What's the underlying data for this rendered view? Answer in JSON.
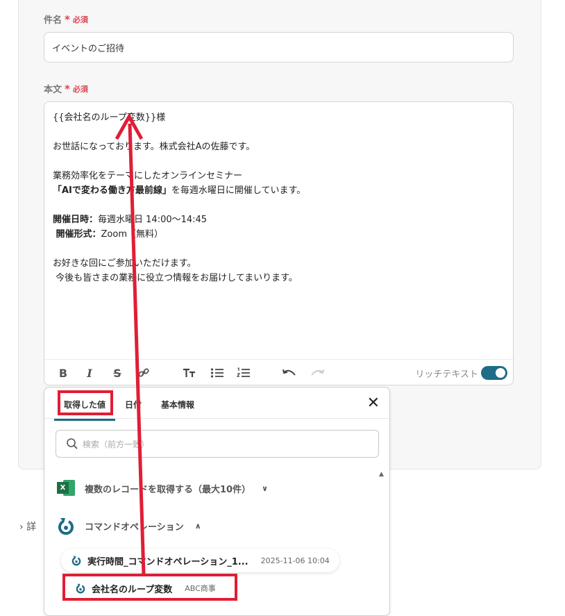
{
  "form": {
    "subject_label": "件名",
    "body_label": "本文",
    "required_star": "*",
    "required_text": "必須",
    "subject_value": "イベントのご招待",
    "body_lines": [
      {
        "text": "{{会社名のループ変数}}様",
        "bold": false
      },
      {
        "text": "",
        "bold": false
      },
      {
        "text": "お世話になっております。株式会社Aの佐藤です。",
        "bold": false
      },
      {
        "text": "",
        "bold": false
      },
      {
        "text": "業務効率化をテーマにしたオンラインセミナー",
        "bold": false
      },
      {
        "text": "「AIで変わる働き方最前線」を毎週水曜日に開催しています。",
        "bold": false,
        "bold_part": "「AIで変わる働き方最前線」"
      },
      {
        "text": "",
        "bold": false
      },
      {
        "text": "開催日時：毎週水曜日 14:00〜14:45",
        "bold": false,
        "bold_part": "開催日時："
      },
      {
        "text": " 開催形式：Zoom（無料）",
        "bold": false,
        "bold_part": " 開催形式："
      },
      {
        "text": "",
        "bold": false
      },
      {
        "text": "お好きな回にご参加いただけます。",
        "bold": false
      },
      {
        "text": " 今後も皆さまの業務に役立つ情報をお届けしてまいります。",
        "bold": false
      }
    ]
  },
  "toolbar": {
    "bold": "B",
    "italic": "I",
    "strike": "S",
    "rich_text_label": "リッチテキスト",
    "rich_text_on": true
  },
  "panel": {
    "tabs": [
      "取得した値",
      "日付",
      "基本情報"
    ],
    "active_tab": 0,
    "search_placeholder": "検索（前方一致）",
    "groups": [
      {
        "label": "複数のレコードを取得する（最大10件）",
        "icon": "excel-icon",
        "expanded": false
      },
      {
        "label": "コマンドオペレーション",
        "icon": "command-operation-icon",
        "expanded": true
      }
    ],
    "items": [
      {
        "label": "実行時間_コマンドオペレーション_1...",
        "value": "2025-11-06 10:04"
      },
      {
        "label": "会社名のループ変数",
        "value": "ABC商事"
      }
    ]
  },
  "detail_label": "詳",
  "colors": {
    "accent": "#1e6c87",
    "required": "#e0424f",
    "highlight": "#e01e35"
  }
}
